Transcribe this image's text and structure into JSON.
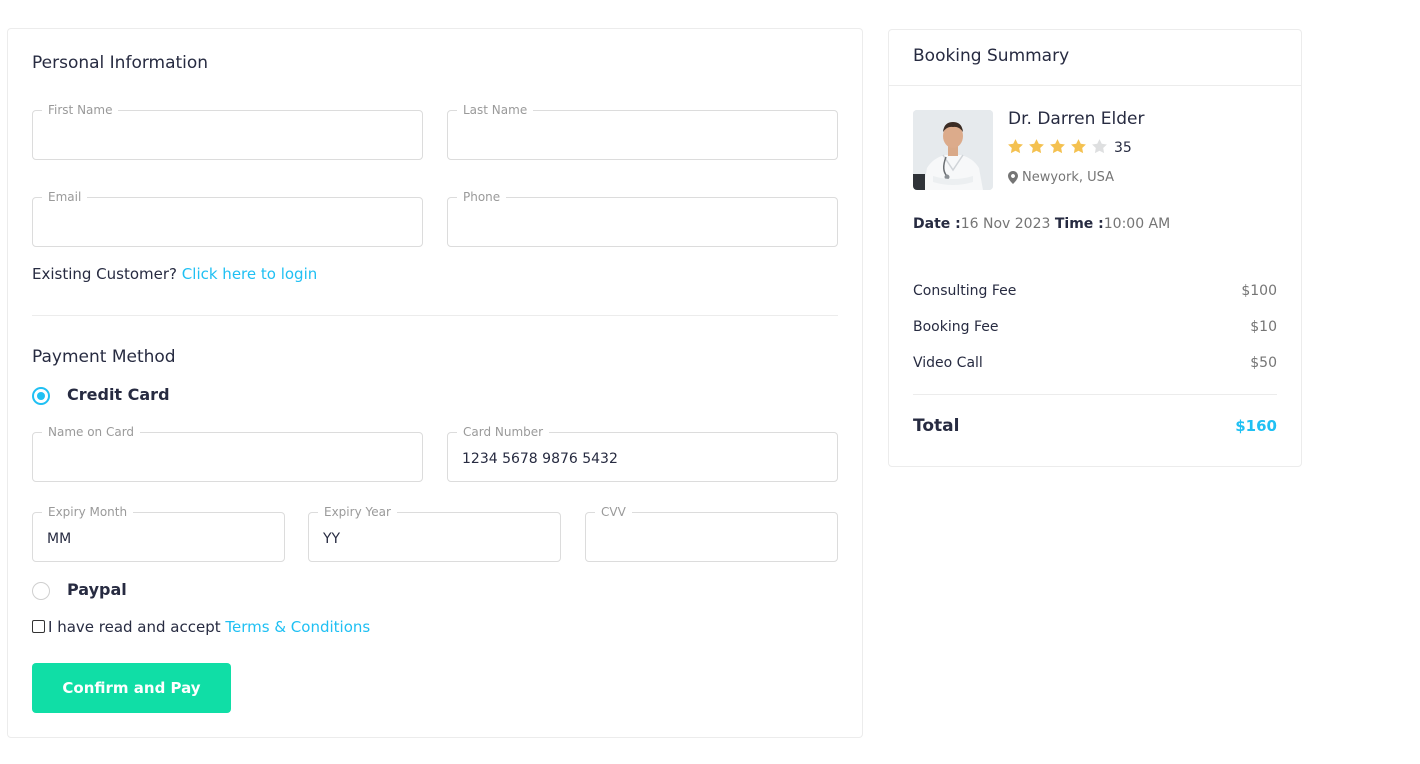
{
  "personal": {
    "title": "Personal Information",
    "first_name_label": "First Name",
    "last_name_label": "Last Name",
    "email_label": "Email",
    "phone_label": "Phone",
    "existing_text": "Existing Customer?",
    "login_link": "Click here to login"
  },
  "payment": {
    "title": "Payment Method",
    "credit_card_label": "Credit Card",
    "name_on_card_label": "Name on Card",
    "card_number_label": "Card Number",
    "card_number_value": "1234 5678 9876 5432",
    "expiry_month_label": "Expiry Month",
    "expiry_month_placeholder": "MM",
    "expiry_year_label": "Expiry Year",
    "expiry_year_placeholder": "YY",
    "cvv_label": "CVV",
    "paypal_label": "Paypal",
    "terms_text": "I have read and accept",
    "terms_link": "Terms & Conditions",
    "confirm_button": "Confirm and Pay"
  },
  "summary": {
    "title": "Booking Summary",
    "doctor_name": "Dr. Darren Elder",
    "rating": 4,
    "rating_max": 5,
    "review_count": "35",
    "location": "Newyork, USA",
    "date_label": "Date :",
    "date_value": "16 Nov 2023",
    "time_label": "Time :",
    "time_value": "10:00 AM",
    "fees": [
      {
        "name": "Consulting Fee",
        "value": "$100"
      },
      {
        "name": "Booking Fee",
        "value": "$10"
      },
      {
        "name": "Video Call",
        "value": "$50"
      }
    ],
    "total_label": "Total",
    "total_value": "$160"
  },
  "colors": {
    "accent": "#20c0f3",
    "button": "#10dea6",
    "star_filled": "#f4c150",
    "star_empty": "#dedfe0"
  }
}
